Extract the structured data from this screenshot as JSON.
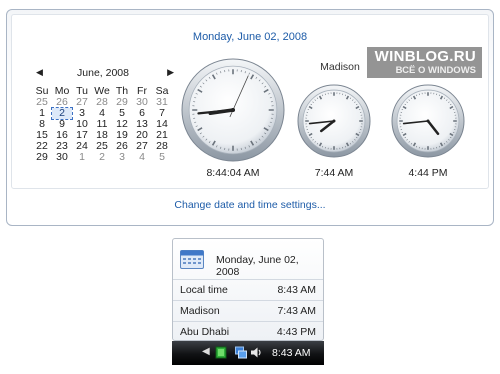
{
  "flyout": {
    "date_header": "Monday, June 02, 2008",
    "calendar": {
      "month_label": "June, 2008",
      "weekdays": [
        "Su",
        "Mo",
        "Tu",
        "We",
        "Th",
        "Fr",
        "Sa"
      ],
      "days": [
        {
          "d": "25",
          "other": true
        },
        {
          "d": "26",
          "other": true
        },
        {
          "d": "27",
          "other": true
        },
        {
          "d": "28",
          "other": true
        },
        {
          "d": "29",
          "other": true
        },
        {
          "d": "30",
          "other": true
        },
        {
          "d": "31",
          "other": true
        },
        {
          "d": "1"
        },
        {
          "d": "2",
          "today": true
        },
        {
          "d": "3"
        },
        {
          "d": "4"
        },
        {
          "d": "5"
        },
        {
          "d": "6"
        },
        {
          "d": "7"
        },
        {
          "d": "8"
        },
        {
          "d": "9"
        },
        {
          "d": "10"
        },
        {
          "d": "11"
        },
        {
          "d": "12"
        },
        {
          "d": "13"
        },
        {
          "d": "14"
        },
        {
          "d": "15"
        },
        {
          "d": "16"
        },
        {
          "d": "17"
        },
        {
          "d": "18"
        },
        {
          "d": "19"
        },
        {
          "d": "20"
        },
        {
          "d": "21"
        },
        {
          "d": "22"
        },
        {
          "d": "23"
        },
        {
          "d": "24"
        },
        {
          "d": "25"
        },
        {
          "d": "26"
        },
        {
          "d": "27"
        },
        {
          "d": "28"
        },
        {
          "d": "29"
        },
        {
          "d": "30"
        },
        {
          "d": "1",
          "other": true
        },
        {
          "d": "2",
          "other": true
        },
        {
          "d": "3",
          "other": true
        },
        {
          "d": "4",
          "other": true
        },
        {
          "d": "5",
          "other": true
        }
      ]
    },
    "clocks": [
      {
        "city": "",
        "time": "8:44:04 AM",
        "h": 8,
        "m": 44,
        "s": 4,
        "show_seconds": true
      },
      {
        "city": "Madison",
        "time": "7:44 AM",
        "h": 7,
        "m": 44,
        "s": 0,
        "show_seconds": false
      },
      {
        "city": "",
        "time": "4:44 PM",
        "h": 16,
        "m": 44,
        "s": 0,
        "show_seconds": false
      }
    ],
    "change_link": "Change date and time settings..."
  },
  "watermark": {
    "title": "WINBLOG.RU",
    "subtitle": "ВСЁ О WINDOWS"
  },
  "tray_popup": {
    "date": "Monday, June 02, 2008",
    "rows": [
      {
        "label": "Local time",
        "time": "8:43 AM"
      },
      {
        "label": "Madison",
        "time": "7:43 AM"
      },
      {
        "label": "Abu Dhabi",
        "time": "4:43 PM"
      }
    ]
  },
  "taskbar": {
    "clock": "8:43 AM",
    "icons": [
      "show-hidden-icons-arrow-icon",
      "network-status-icon",
      "network-connection-icon",
      "volume-icon"
    ]
  },
  "colors": {
    "link": "#1e5ca8",
    "today_highlight": "#dde9f9",
    "taskbar": "#111214"
  }
}
